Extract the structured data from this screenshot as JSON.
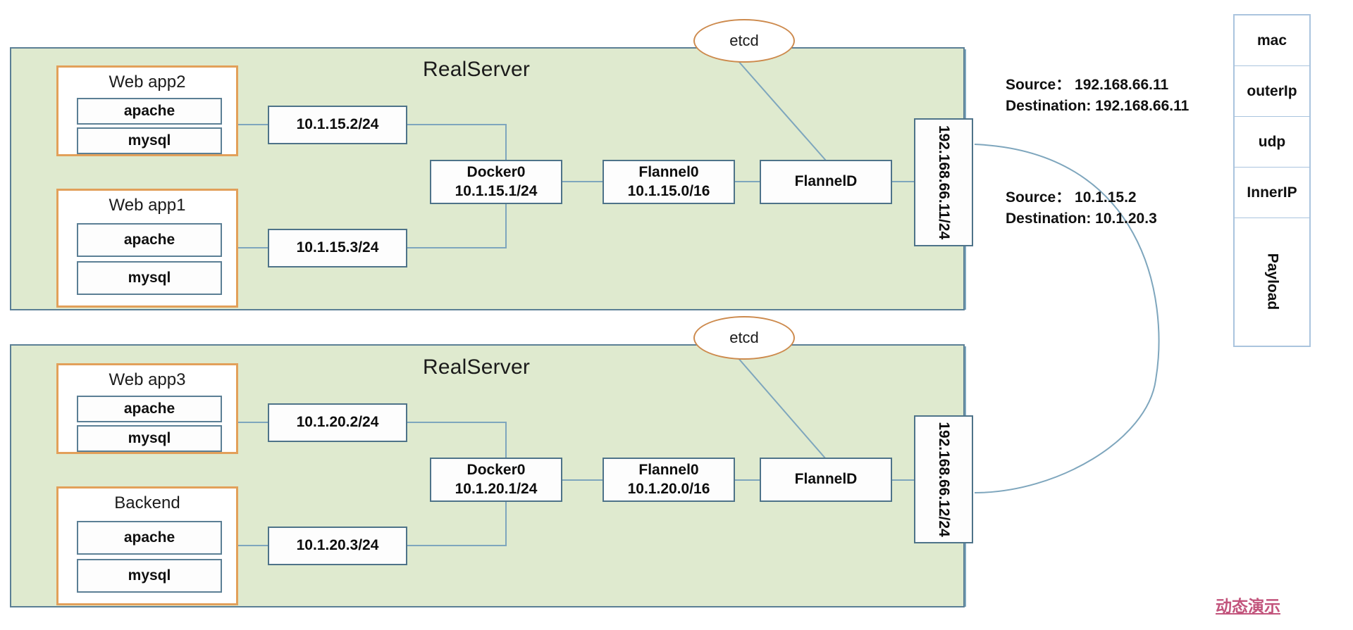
{
  "servers": [
    {
      "title": "RealServer",
      "etcd_label": "etcd",
      "apps": [
        {
          "name": "Web app2",
          "services": [
            "apache",
            "mysql"
          ],
          "ip": "10.1.15.2/24"
        },
        {
          "name": "Web app1",
          "services": [
            "apache",
            "mysql"
          ],
          "ip": "10.1.15.3/24"
        }
      ],
      "docker": {
        "name": "Docker0",
        "ip": "10.1.15.1/24"
      },
      "flannel0": {
        "name": "Flannel0",
        "ip": "10.1.15.0/16"
      },
      "flanneld": "FlannelD",
      "host_ip": "192.168.66.11/24"
    },
    {
      "title": "RealServer",
      "etcd_label": "etcd",
      "apps": [
        {
          "name": "Web app3",
          "services": [
            "apache",
            "mysql"
          ],
          "ip": "10.1.20.2/24"
        },
        {
          "name": "Backend",
          "services": [
            "apache",
            "mysql"
          ],
          "ip": "10.1.20.3/24"
        }
      ],
      "docker": {
        "name": "Docker0",
        "ip": "10.1.20.1/24"
      },
      "flannel0": {
        "name": "Flannel0",
        "ip": "10.1.20.0/16"
      },
      "flanneld": "FlannelD",
      "host_ip": "192.168.66.12/24"
    }
  ],
  "annotations": [
    {
      "source": "Source： 192.168.66.11",
      "destination": "Destination:  192.168.66.11"
    },
    {
      "source": "Source： 10.1.15.2",
      "destination": "Destination:  10.1.20.3"
    }
  ],
  "packet": {
    "layers": [
      "mac",
      "outerIp",
      "udp",
      "InnerIP",
      "Payload"
    ]
  },
  "watermark": "动态演示",
  "colors": {
    "panel_fill": "#dfeacf",
    "panel_border": "#5b7f95",
    "app_border": "#e2a05a",
    "node_border": "#4e7389",
    "link": "#7ea6bd",
    "etcd_border": "#cd8a4d",
    "packet_border": "#aac4de",
    "watermark": "#c2547c"
  }
}
